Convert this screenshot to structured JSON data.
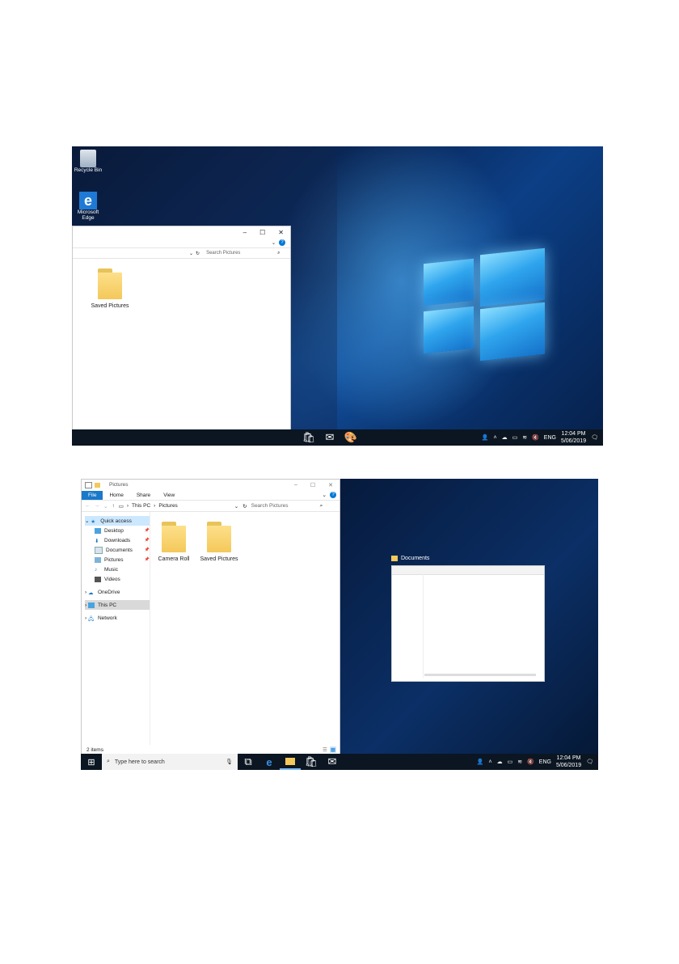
{
  "top_shot": {
    "desktop_icons": [
      {
        "name": "recycle-bin",
        "label": "Recycle Bin"
      },
      {
        "name": "edge",
        "label": "Microsoft Edge"
      }
    ],
    "window": {
      "search_placeholder": "Search Pictures",
      "folders": [
        {
          "label": "Saved Pictures"
        }
      ],
      "min": "–",
      "max": "☐",
      "close": "✕"
    },
    "tray": {
      "lang": "ENG",
      "time": "12:04 PM",
      "date": "5/06/2019"
    }
  },
  "bottom_shot": {
    "window": {
      "title": "Pictures",
      "ribbon_tabs": [
        "File",
        "Home",
        "Share",
        "View"
      ],
      "path": [
        "This PC",
        "Pictures"
      ],
      "search_placeholder": "Search Pictures",
      "nav": {
        "quick_access": "Quick access",
        "items": [
          "Desktop",
          "Downloads",
          "Documents",
          "Pictures",
          "Music",
          "Videos"
        ],
        "onedrive": "OneDrive",
        "this_pc": "This PC",
        "network": "Network"
      },
      "folders": [
        {
          "label": "Camera Roll"
        },
        {
          "label": "Saved Pictures"
        }
      ],
      "status": "2 items",
      "min": "–",
      "max": "☐",
      "close": "✕"
    },
    "snap_preview": {
      "title": "Documents"
    },
    "taskbar": {
      "search_placeholder": "Type here to search"
    },
    "tray": {
      "lang": "ENG",
      "time": "12:04 PM",
      "date": "5/06/2019"
    }
  },
  "colors": {
    "accent": "#0078d7",
    "folder": "#f4c85a",
    "taskbar": "#0b1622"
  }
}
